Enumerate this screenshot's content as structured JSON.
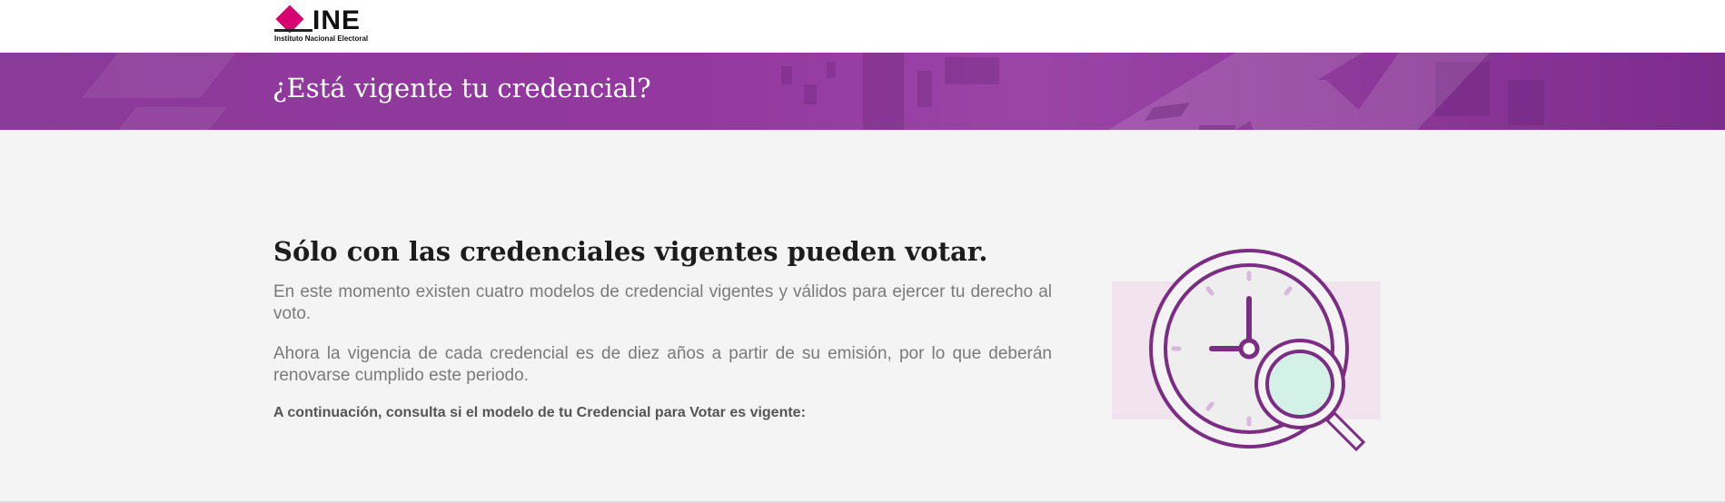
{
  "header": {
    "logo": {
      "wordmark": "INE",
      "subtitle": "Instituto Nacional Electoral"
    }
  },
  "banner": {
    "title": "¿Está vigente tu credencial?"
  },
  "main": {
    "heading": "Sólo con las credenciales vigentes pueden votar.",
    "paragraph_1": "En este momento existen cuatro modelos de credencial vigentes y válidos para ejercer tu derecho al voto.",
    "paragraph_2": "Ahora la vigencia de cada credencial es de diez años a partir de su emisión, por lo que deberán renovarse cumplido este periodo.",
    "cta_text": "A continuación, consulta si el modelo de tu Credencial para Votar es vigente:"
  },
  "illustration": {
    "icon": "clock-magnifier-icon"
  },
  "colors": {
    "brand_magenta": "#d6006f",
    "banner_purple": "#93389f",
    "clock_purple": "#7b2d84",
    "lens_mint": "#d3f1e6",
    "page_bg": "#f4f4f4"
  }
}
